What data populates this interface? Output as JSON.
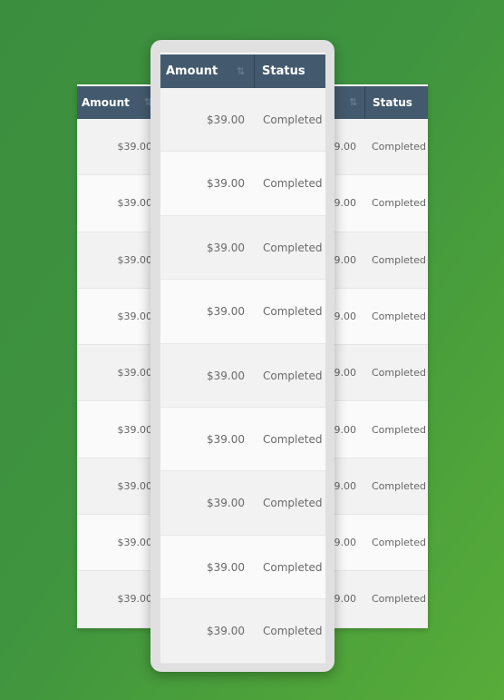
{
  "headers": {
    "amount": "Amount",
    "status": "Status"
  },
  "icons": {
    "sort": "sort-arrows-icon"
  },
  "colors": {
    "header": "#435a6e",
    "background": "#3f943f"
  },
  "back_rows": [
    {
      "amount": "$39.00",
      "status": "Completed"
    },
    {
      "amount": "$39.00",
      "status": "Completed"
    },
    {
      "amount": "$39.00",
      "status": "Completed"
    },
    {
      "amount": "$39.00",
      "status": "Completed"
    },
    {
      "amount": "$39.00",
      "status": "Completed"
    },
    {
      "amount": "$39.00",
      "status": "Completed"
    },
    {
      "amount": "$39.00",
      "status": "Completed"
    },
    {
      "amount": "$39.00",
      "status": "Completed"
    },
    {
      "amount": "$39.00",
      "status": "Completed"
    }
  ],
  "front_rows": [
    {
      "amount": "$39.00",
      "status": "Completed"
    },
    {
      "amount": "$39.00",
      "status": "Completed"
    },
    {
      "amount": "$39.00",
      "status": "Completed"
    },
    {
      "amount": "$39.00",
      "status": "Completed"
    },
    {
      "amount": "$39.00",
      "status": "Completed"
    },
    {
      "amount": "$39.00",
      "status": "Completed"
    },
    {
      "amount": "$39.00",
      "status": "Completed"
    },
    {
      "amount": "$39.00",
      "status": "Completed"
    },
    {
      "amount": "$39.00",
      "status": "Completed"
    }
  ]
}
